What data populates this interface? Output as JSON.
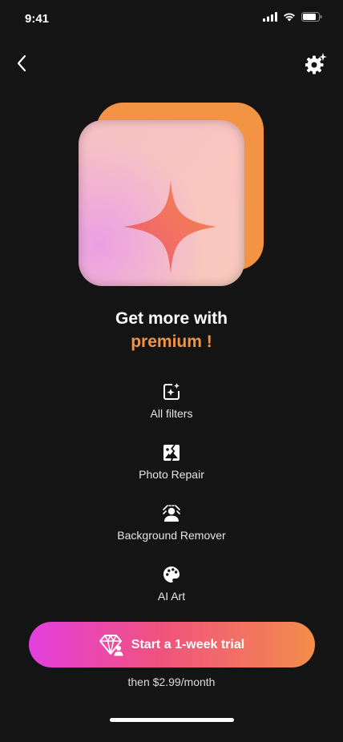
{
  "status_bar": {
    "time": "9:41"
  },
  "header": {
    "back_icon": "chevron-left-icon",
    "settings_icon": "gear-sparkle-icon"
  },
  "hero": {
    "icon": "four-point-star-icon"
  },
  "headline": {
    "line1": "Get more with",
    "line2": "premium !"
  },
  "features": [
    {
      "label": "All filters",
      "icon": "image-sparkle-icon"
    },
    {
      "label": "Photo Repair",
      "icon": "image-repair-icon"
    },
    {
      "label": "Background Remover",
      "icon": "person-background-icon"
    },
    {
      "label": "AI Art",
      "icon": "palette-icon"
    }
  ],
  "cta": {
    "label": "Start a 1-week trial",
    "icon": "diamond-person-icon",
    "subtext": "then $2.99/month"
  },
  "colors": {
    "background": "#141414",
    "accent": "#f39444",
    "cta_gradient_start": "#e43fe0",
    "cta_gradient_end": "#f38d4b"
  }
}
